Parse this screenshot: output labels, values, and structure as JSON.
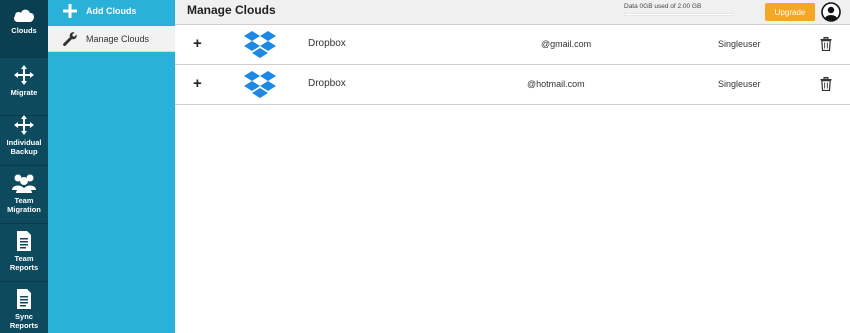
{
  "rail": {
    "items": [
      {
        "label": "Clouds",
        "icon": "cloud-icon"
      },
      {
        "label": "Migrate",
        "icon": "move-arrows-icon"
      },
      {
        "label_line1": "Individual",
        "label_line2": "Backup",
        "icon": "move-arrows-icon"
      },
      {
        "label_line1": "Team",
        "label_line2": "Migration",
        "icon": "team-icon"
      },
      {
        "label_line1": "Team",
        "label_line2": "Reports",
        "icon": "document-icon"
      },
      {
        "label_line1": "Sync",
        "label_line2": "Reports",
        "icon": "document-icon"
      }
    ]
  },
  "sidebar": {
    "add_label": "Add Clouds",
    "manage_label": "Manage Clouds"
  },
  "header": {
    "title": "Manage Clouds",
    "usage_text": "Data 0GB used of 2.00 GB",
    "usage_fraction": 0,
    "upgrade_label": "Upgrade"
  },
  "clouds": [
    {
      "expand": "+",
      "provider": "Dropbox",
      "email": "@gmail.com",
      "type": "Singleuser"
    },
    {
      "expand": "+",
      "provider": "Dropbox",
      "email": "@hotmail.com",
      "type": "Singleuser"
    }
  ],
  "colors": {
    "rail_bg": "#0d4a5e",
    "sidebar_bg": "#29b1d9",
    "dropbox_blue": "#1e88e5",
    "upgrade_orange": "#f5a623"
  }
}
